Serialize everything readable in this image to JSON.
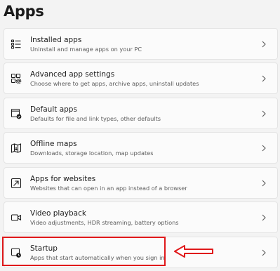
{
  "page": {
    "title": "Apps"
  },
  "items": [
    {
      "title": "Installed apps",
      "description": "Uninstall and manage apps on your PC",
      "icon": "installed-apps-icon"
    },
    {
      "title": "Advanced app settings",
      "description": "Choose where to get apps, archive apps, uninstall updates",
      "icon": "advanced-app-settings-icon"
    },
    {
      "title": "Default apps",
      "description": "Defaults for file and link types, other defaults",
      "icon": "default-apps-icon"
    },
    {
      "title": "Offline maps",
      "description": "Downloads, storage location, map updates",
      "icon": "offline-maps-icon"
    },
    {
      "title": "Apps for websites",
      "description": "Websites that can open in an app instead of a browser",
      "icon": "apps-for-websites-icon"
    },
    {
      "title": "Video playback",
      "description": "Video adjustments, HDR streaming, battery options",
      "icon": "video-playback-icon"
    },
    {
      "title": "Startup",
      "description": "Apps that start automatically when you sign in",
      "icon": "startup-icon"
    }
  ],
  "annotation": {
    "color": "#e0191b",
    "highlighted_item": "Startup"
  },
  "colors": {
    "background": "#f3f3f3",
    "card": "#fbfbfb",
    "text_primary": "#1b1b1b",
    "text_secondary": "#5c5c5c"
  }
}
